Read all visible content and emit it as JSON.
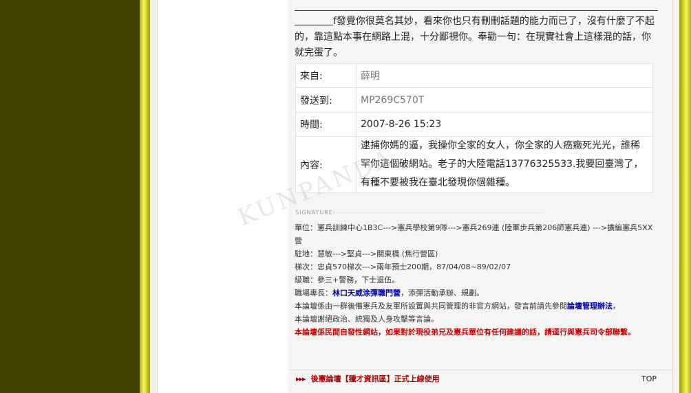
{
  "post": {
    "intro_text": "f發覺你很莫名其妙，看來你也只有刪刪話題的能力而已了，沒有什麼了不起的，靠這點本事在網路上混，十分鄙視你。奉勸一句：在現實社會上這樣混的話，你就完蛋了。"
  },
  "message": {
    "from_label": "來自:",
    "from_value": "薛明",
    "to_label": "發送到:",
    "to_value": "MP269C570T",
    "time_label": "時間:",
    "time_value": "2007-8-26 15:23",
    "content_label": "內容:",
    "content_value": "逮捕你媽的逼，我操你全家的女人，你全家的人癌癥死光光，誰稀罕你這個破網站。老子的大陸電話13776325533.我要回臺灣了，有種不要被我在臺北發現你個雜種。"
  },
  "signature": {
    "label": "SIGNATURE",
    "line1": "單位：憲兵訓練中心1B3C--->憲兵學校第9隊--->憲兵269連 (陸軍步兵第206師憲兵連) --->擴編憲兵5XX營",
    "line2": "駐地：慧敏--->堅貞--->關東橋 (焦行營區)",
    "line3": "梯次：忠貞570梯次--->兩年預士200期，87/04/08~89/02/07",
    "line4": "級職：參三+警務，下士退伍。",
    "line5_prefix": "職場專長：",
    "line5_highlight": "林口天威涂彈職門營",
    "line5_suffix": "，添彈活動承辦、規劃。",
    "line6_prefix": "本論壇係由一群後備憲兵及友軍所設置與共同管理的非官方網站，發言前請先參閱",
    "line6_highlight": "論壇管理辦法",
    "line6_suffix": "，",
    "line7": "本論壇謝絕政治、統獨及人身攻擊等言論。",
    "line8": "本論壇係民間自發性網站，如果對於現役弟兄及憲兵單位有任何建議的話，請逕行與憲兵司令部聯繫。"
  },
  "watermark": "KUNPANDA",
  "footer": {
    "arrows": "▸▸▸",
    "link_text": "後憲論壇【獵才資訊區】正式上線使用",
    "top_label": "TOP"
  },
  "colors": {
    "olive_dark": "#434300",
    "olive_bar": "#dede28",
    "link_red": "#aa0000",
    "link_blue": "#0000aa"
  }
}
